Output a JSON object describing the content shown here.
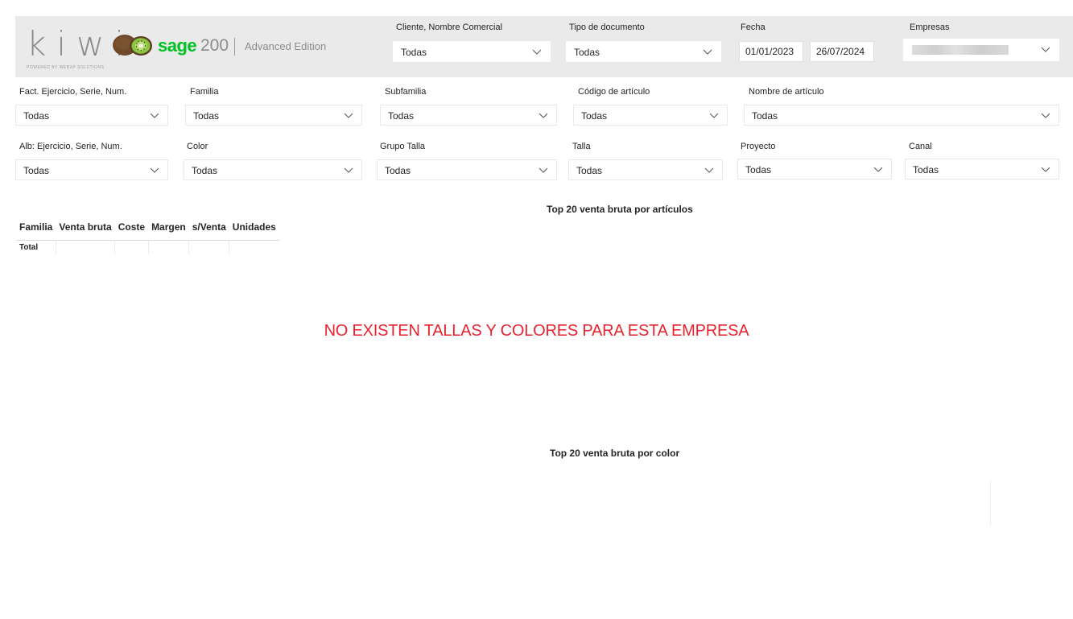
{
  "logo": {
    "kiwi": "kiwi",
    "tagline": "POWERED BY WEBXP SOLUTIONS",
    "sage": "sage",
    "version": "200",
    "edition": "Advanced Edition"
  },
  "filters": {
    "cliente": {
      "label": "Cliente, Nombre Comercial",
      "value": "Todas"
    },
    "tipo_documento": {
      "label": "Tipo de documento",
      "value": "Todas"
    },
    "fecha": {
      "label": "Fecha",
      "from": "01/01/2023",
      "to": "26/07/2024"
    },
    "empresas": {
      "label": "Empresas"
    },
    "fact": {
      "label": "Fact. Ejercicio, Serie, Num.",
      "value": "Todas"
    },
    "familia": {
      "label": "Familia",
      "value": "Todas"
    },
    "subfamilia": {
      "label": "Subfamilia",
      "value": "Todas"
    },
    "codigo_articulo": {
      "label": "Código de artículo",
      "value": "Todas"
    },
    "nombre_articulo": {
      "label": "Nombre de artículo",
      "value": "Todas"
    },
    "alb": {
      "label": "Alb: Ejercicio, Serie, Num.",
      "value": "Todas"
    },
    "color": {
      "label": "Color",
      "value": "Todas"
    },
    "grupo_talla": {
      "label": "Grupo Talla",
      "value": "Todas"
    },
    "talla": {
      "label": "Talla",
      "value": "Todas"
    },
    "proyecto": {
      "label": "Proyecto",
      "value": "Todas"
    },
    "canal": {
      "label": "Canal",
      "value": "Todas"
    }
  },
  "table": {
    "columns": [
      "Familia",
      "Venta bruta",
      "Coste",
      "Margen",
      "s/Venta",
      "Unidades"
    ],
    "total_label": "Total"
  },
  "visuals": {
    "top_articulos_title": "Top 20 venta bruta por artículos",
    "top_color_title": "Top 20 venta bruta por color"
  },
  "message": "NO EXISTEN TALLAS Y COLORES PARA ESTA EMPRESA",
  "colors": {
    "header_band": "#eaeaea",
    "sage_green": "#00c124",
    "alert_red": "#e8232f"
  }
}
